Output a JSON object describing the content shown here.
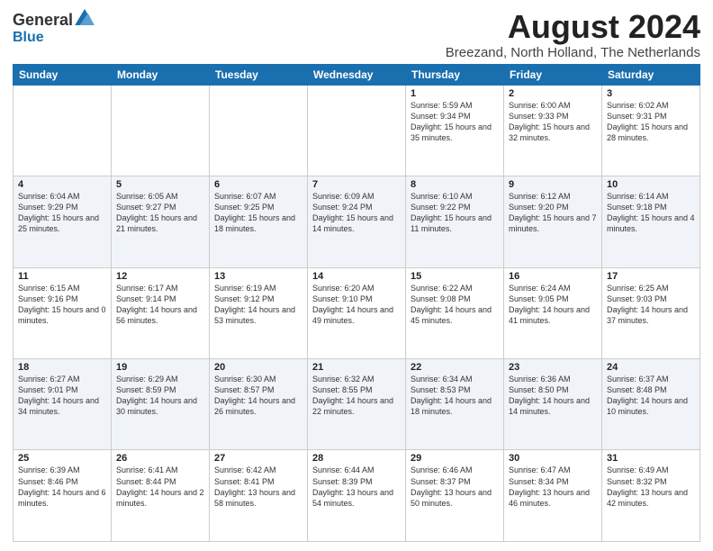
{
  "logo": {
    "general": "General",
    "blue": "Blue"
  },
  "title": "August 2024",
  "location": "Breezand, North Holland, The Netherlands",
  "days_of_week": [
    "Sunday",
    "Monday",
    "Tuesday",
    "Wednesday",
    "Thursday",
    "Friday",
    "Saturday"
  ],
  "weeks": [
    [
      {
        "day": "",
        "info": ""
      },
      {
        "day": "",
        "info": ""
      },
      {
        "day": "",
        "info": ""
      },
      {
        "day": "",
        "info": ""
      },
      {
        "day": "1",
        "sunrise": "5:59 AM",
        "sunset": "9:34 PM",
        "daylight": "15 hours and 35 minutes."
      },
      {
        "day": "2",
        "sunrise": "6:00 AM",
        "sunset": "9:33 PM",
        "daylight": "15 hours and 32 minutes."
      },
      {
        "day": "3",
        "sunrise": "6:02 AM",
        "sunset": "9:31 PM",
        "daylight": "15 hours and 28 minutes."
      }
    ],
    [
      {
        "day": "4",
        "sunrise": "6:04 AM",
        "sunset": "9:29 PM",
        "daylight": "15 hours and 25 minutes."
      },
      {
        "day": "5",
        "sunrise": "6:05 AM",
        "sunset": "9:27 PM",
        "daylight": "15 hours and 21 minutes."
      },
      {
        "day": "6",
        "sunrise": "6:07 AM",
        "sunset": "9:25 PM",
        "daylight": "15 hours and 18 minutes."
      },
      {
        "day": "7",
        "sunrise": "6:09 AM",
        "sunset": "9:24 PM",
        "daylight": "15 hours and 14 minutes."
      },
      {
        "day": "8",
        "sunrise": "6:10 AM",
        "sunset": "9:22 PM",
        "daylight": "15 hours and 11 minutes."
      },
      {
        "day": "9",
        "sunrise": "6:12 AM",
        "sunset": "9:20 PM",
        "daylight": "15 hours and 7 minutes."
      },
      {
        "day": "10",
        "sunrise": "6:14 AM",
        "sunset": "9:18 PM",
        "daylight": "15 hours and 4 minutes."
      }
    ],
    [
      {
        "day": "11",
        "sunrise": "6:15 AM",
        "sunset": "9:16 PM",
        "daylight": "15 hours and 0 minutes."
      },
      {
        "day": "12",
        "sunrise": "6:17 AM",
        "sunset": "9:14 PM",
        "daylight": "14 hours and 56 minutes."
      },
      {
        "day": "13",
        "sunrise": "6:19 AM",
        "sunset": "9:12 PM",
        "daylight": "14 hours and 53 minutes."
      },
      {
        "day": "14",
        "sunrise": "6:20 AM",
        "sunset": "9:10 PM",
        "daylight": "14 hours and 49 minutes."
      },
      {
        "day": "15",
        "sunrise": "6:22 AM",
        "sunset": "9:08 PM",
        "daylight": "14 hours and 45 minutes."
      },
      {
        "day": "16",
        "sunrise": "6:24 AM",
        "sunset": "9:05 PM",
        "daylight": "14 hours and 41 minutes."
      },
      {
        "day": "17",
        "sunrise": "6:25 AM",
        "sunset": "9:03 PM",
        "daylight": "14 hours and 37 minutes."
      }
    ],
    [
      {
        "day": "18",
        "sunrise": "6:27 AM",
        "sunset": "9:01 PM",
        "daylight": "14 hours and 34 minutes."
      },
      {
        "day": "19",
        "sunrise": "6:29 AM",
        "sunset": "8:59 PM",
        "daylight": "14 hours and 30 minutes."
      },
      {
        "day": "20",
        "sunrise": "6:30 AM",
        "sunset": "8:57 PM",
        "daylight": "14 hours and 26 minutes."
      },
      {
        "day": "21",
        "sunrise": "6:32 AM",
        "sunset": "8:55 PM",
        "daylight": "14 hours and 22 minutes."
      },
      {
        "day": "22",
        "sunrise": "6:34 AM",
        "sunset": "8:53 PM",
        "daylight": "14 hours and 18 minutes."
      },
      {
        "day": "23",
        "sunrise": "6:36 AM",
        "sunset": "8:50 PM",
        "daylight": "14 hours and 14 minutes."
      },
      {
        "day": "24",
        "sunrise": "6:37 AM",
        "sunset": "8:48 PM",
        "daylight": "14 hours and 10 minutes."
      }
    ],
    [
      {
        "day": "25",
        "sunrise": "6:39 AM",
        "sunset": "8:46 PM",
        "daylight": "14 hours and 6 minutes."
      },
      {
        "day": "26",
        "sunrise": "6:41 AM",
        "sunset": "8:44 PM",
        "daylight": "14 hours and 2 minutes."
      },
      {
        "day": "27",
        "sunrise": "6:42 AM",
        "sunset": "8:41 PM",
        "daylight": "13 hours and 58 minutes."
      },
      {
        "day": "28",
        "sunrise": "6:44 AM",
        "sunset": "8:39 PM",
        "daylight": "13 hours and 54 minutes."
      },
      {
        "day": "29",
        "sunrise": "6:46 AM",
        "sunset": "8:37 PM",
        "daylight": "13 hours and 50 minutes."
      },
      {
        "day": "30",
        "sunrise": "6:47 AM",
        "sunset": "8:34 PM",
        "daylight": "13 hours and 46 minutes."
      },
      {
        "day": "31",
        "sunrise": "6:49 AM",
        "sunset": "8:32 PM",
        "daylight": "13 hours and 42 minutes."
      }
    ]
  ],
  "labels": {
    "sunrise": "Sunrise:",
    "sunset": "Sunset:",
    "daylight": "Daylight:"
  }
}
